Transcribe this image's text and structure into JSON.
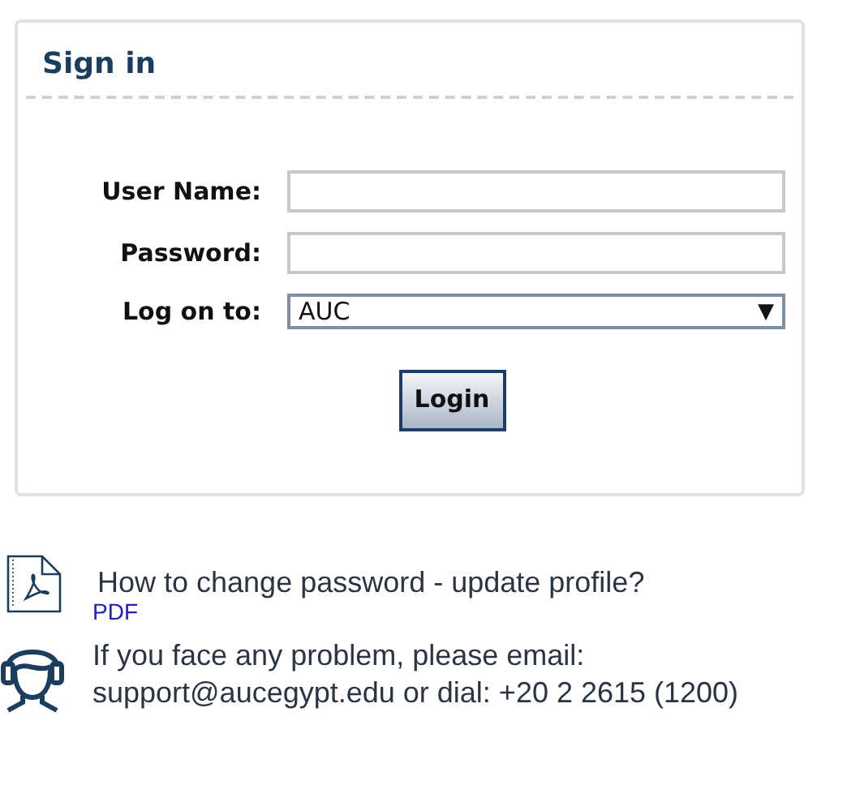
{
  "signin": {
    "title": "Sign in",
    "fields": [
      {
        "kind": "text",
        "label": "User Name:"
      },
      {
        "kind": "password",
        "label": "Password:"
      },
      {
        "kind": "select",
        "label": "Log on to:",
        "value": "AUC",
        "arrow": "▼"
      }
    ],
    "button": "Login"
  },
  "help": [
    {
      "kind": "pdf",
      "text": "How to change password - update profile?",
      "link": "PDF"
    },
    {
      "kind": "support",
      "text": "If you face any problem, please email: support@aucegypt.edu or dial: +20 2 2615 (1200)"
    }
  ]
}
